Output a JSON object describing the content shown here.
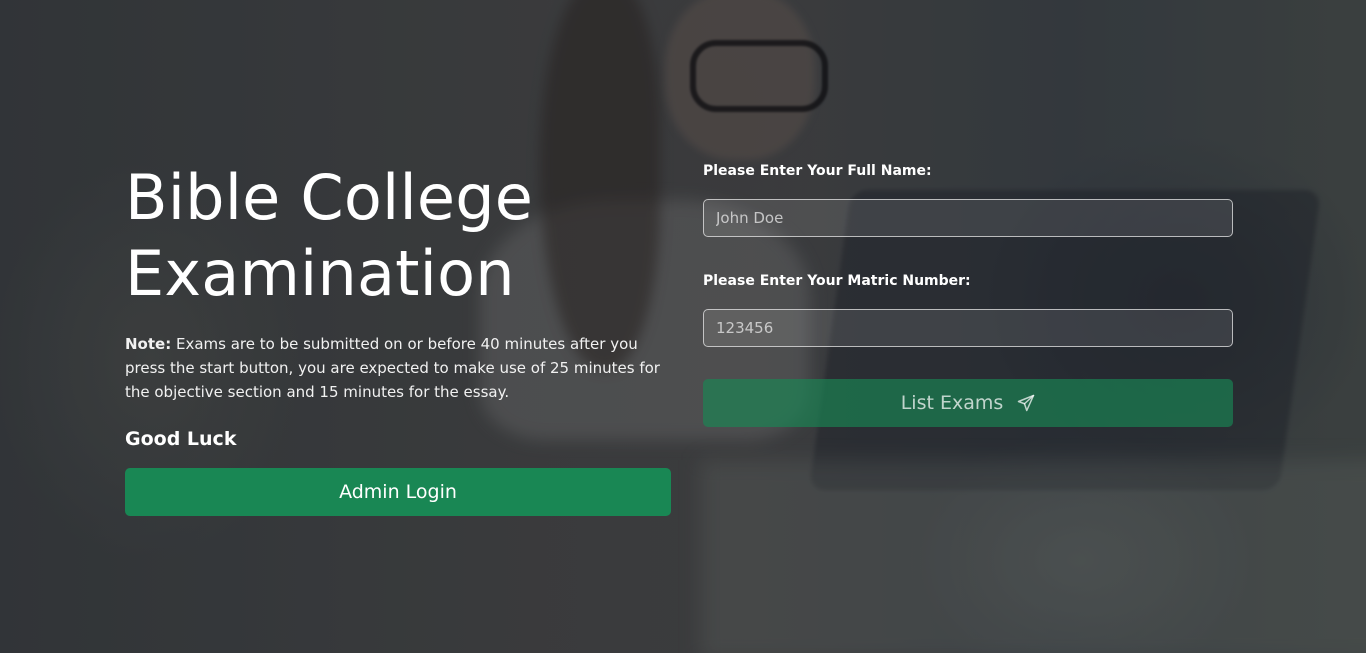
{
  "hero": {
    "title": "Bible College Examination",
    "note_label": "Note:",
    "note_text": "Exams are to be submitted on or before 40 minutes after you press the start button, you are expected to make use of 25 minutes for the objective section and 15 minutes for the essay.",
    "good_luck": "Good Luck",
    "admin_button_label": "Admin Login"
  },
  "form": {
    "full_name": {
      "label": "Please Enter Your Full Name:",
      "placeholder": "John Doe",
      "value": ""
    },
    "matric_number": {
      "label": "Please Enter Your Matric Number:",
      "placeholder": "123456",
      "value": ""
    },
    "submit_label": "List Exams",
    "submit_icon": "send-icon"
  },
  "colors": {
    "primary_green": "#198754",
    "text": "#ffffff"
  }
}
